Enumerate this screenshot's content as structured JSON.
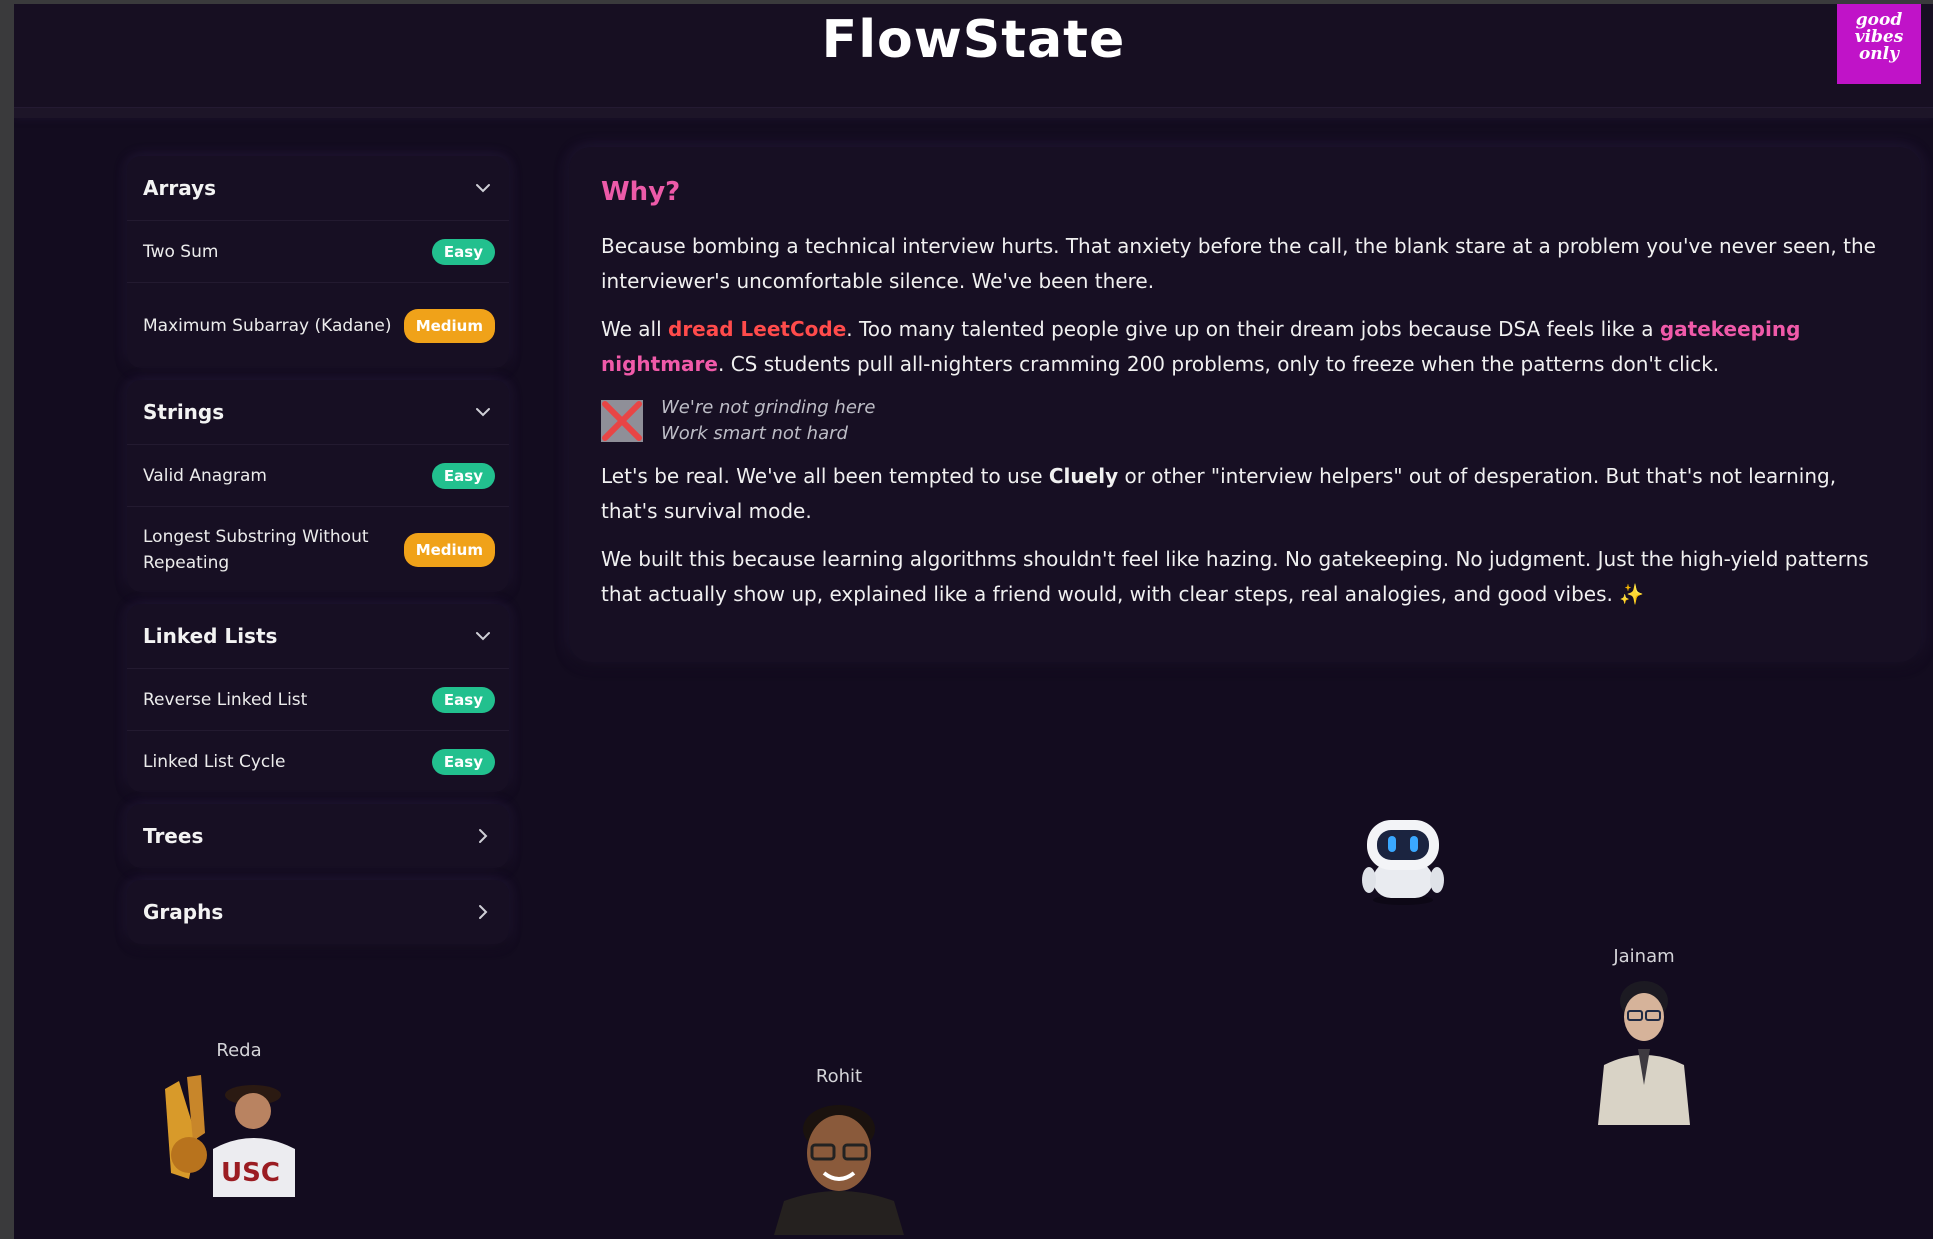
{
  "header": {
    "logo": "FlowState",
    "badge_lines": [
      "good",
      "vibes",
      "only"
    ]
  },
  "sidebar": {
    "sections": [
      {
        "title": "Arrays",
        "expanded": true,
        "items": [
          {
            "label": "Two Sum",
            "difficulty": "Easy"
          },
          {
            "label": "Maximum Subarray (Kadane)",
            "difficulty": "Medium"
          }
        ]
      },
      {
        "title": "Strings",
        "expanded": true,
        "items": [
          {
            "label": "Valid Anagram",
            "difficulty": "Easy"
          },
          {
            "label": "Longest Substring Without Repeating",
            "difficulty": "Medium"
          }
        ]
      },
      {
        "title": "Linked Lists",
        "expanded": true,
        "items": [
          {
            "label": "Reverse Linked List",
            "difficulty": "Easy"
          },
          {
            "label": "Linked List Cycle",
            "difficulty": "Easy"
          }
        ]
      },
      {
        "title": "Trees",
        "expanded": false,
        "items": []
      },
      {
        "title": "Graphs",
        "expanded": false,
        "items": []
      }
    ]
  },
  "why": {
    "title": "Why?",
    "p1": "Because bombing a technical interview hurts. That anxiety before the call, the blank stare at a problem you've never seen, the interviewer's uncomfortable silence. We've been there.",
    "p2_a": "We all ",
    "p2_red": "dread LeetCode",
    "p2_b": ". Too many talented people give up on their dream jobs because DSA feels like a ",
    "p2_pink": "gatekeeping nightmare",
    "p2_c": ". CS students pull all-nighters cramming 200 problems, only to freeze when the patterns don't click.",
    "quote1": "We're not grinding here",
    "quote2": "Work smart not hard",
    "p3_a": "Let's be real. We've all been tempted to use ",
    "p3_bold": "Cluely",
    "p3_b": " or other \"interview helpers\" out of desperation. But that's not learning, that's survival mode.",
    "p4": "We built this because learning algorithms shouldn't feel like hazing. No gatekeeping. No judgment. Just the high-yield patterns that actually show up, explained like a friend would, with clear steps, real analogies, and good vibes. ✨"
  },
  "people": {
    "reda": "Reda",
    "rohit": "Rohit",
    "jainam": "Jainam",
    "usc_text": "USC"
  },
  "colors": {
    "background": "#130c1f",
    "card": "#170f23",
    "accent_pink": "#ec5aa8",
    "accent_red": "#ff4b4b",
    "easy": "#22c08e",
    "medium": "#f0a219",
    "vibes_badge": "#c013c8"
  }
}
